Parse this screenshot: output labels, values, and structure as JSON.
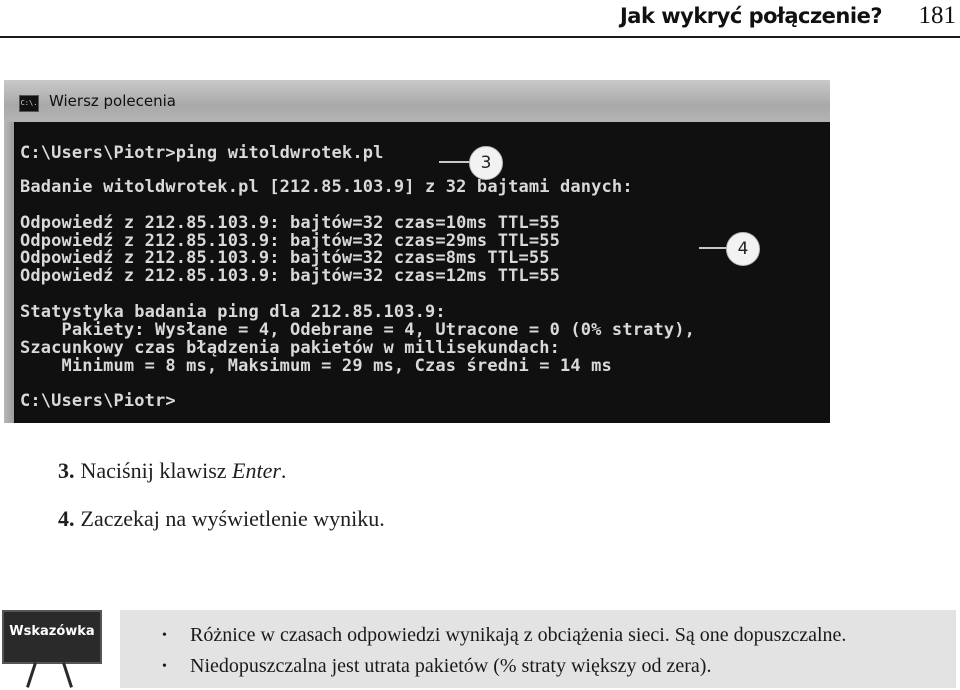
{
  "header": {
    "title": "Jak wykryć połączenie?",
    "page_number": "181"
  },
  "window": {
    "icon_text": "C:\\.",
    "title": "Wiersz polecenia",
    "lines": [
      "C:\\Users\\Piotr>ping witoldwrotek.pl",
      "Badanie witoldwrotek.pl [212.85.103.9] z 32 bajtami danych:",
      "Odpowiedź z 212.85.103.9: bajtów=32 czas=10ms TTL=55",
      "Odpowiedź z 212.85.103.9: bajtów=32 czas=29ms TTL=55",
      "Odpowiedź z 212.85.103.9: bajtów=32 czas=8ms TTL=55",
      "Odpowiedź z 212.85.103.9: bajtów=32 czas=12ms TTL=55",
      "Statystyka badania ping dla 212.85.103.9:",
      "    Pakiety: Wysłane = 4, Odebrane = 4, Utracone = 0 (0% straty),",
      "Szacunkowy czas błądzenia pakietów w millisekundach:",
      "    Minimum = 8 ms, Maksimum = 29 ms, Czas średni = 14 ms",
      "C:\\Users\\Piotr>"
    ]
  },
  "callouts": {
    "first": "3",
    "second": "4"
  },
  "steps": [
    {
      "number": "3.",
      "text": "Naciśnij klawisz ",
      "emphasis": "Enter",
      "suffix": "."
    },
    {
      "number": "4.",
      "text": "Zaczekaj na wyświetlenie wyniku.",
      "emphasis": "",
      "suffix": ""
    }
  ],
  "tip": {
    "label": "Wskazówka",
    "bullet": "•",
    "items": [
      "Różnice w czasach odpowiedzi wynikają z obciążenia sieci. Są one dopuszczalne.",
      "Niedopuszczalna jest utrata pakietów (% straty większy od zera)."
    ]
  }
}
